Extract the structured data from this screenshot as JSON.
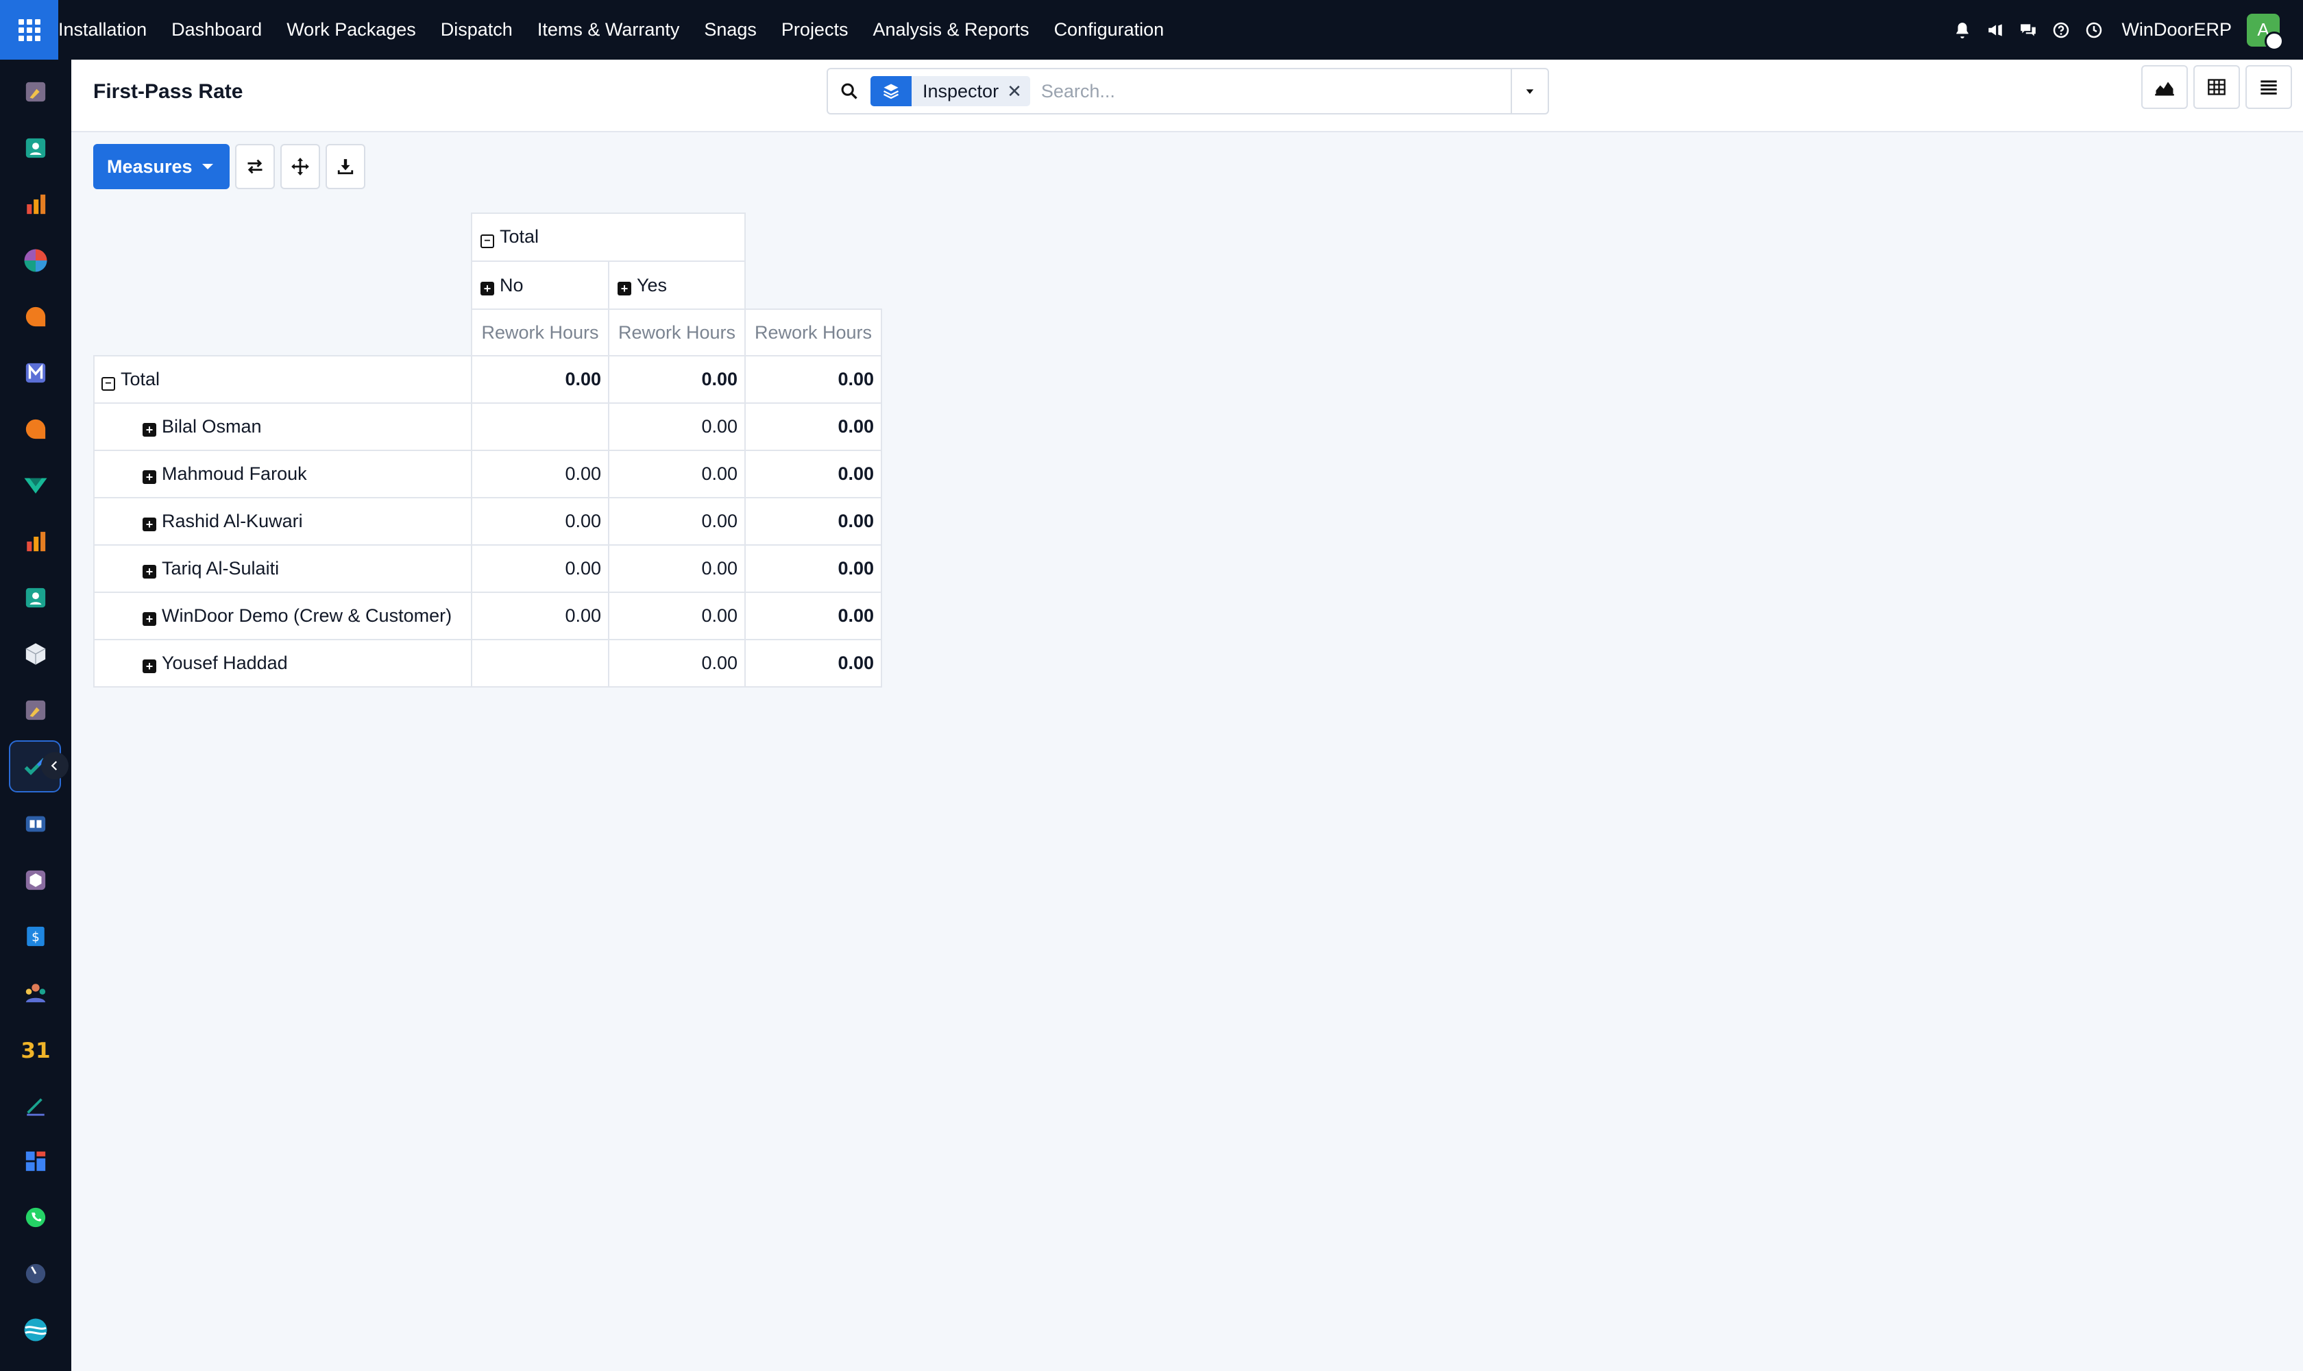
{
  "navbar": {
    "items": [
      "Installation",
      "Dashboard",
      "Work Packages",
      "Dispatch",
      "Items & Warranty",
      "Snags",
      "Projects",
      "Analysis & Reports",
      "Configuration"
    ],
    "company": "WinDoorERP",
    "avatar_initial": "A",
    "accent_color": "#1f6fe0"
  },
  "control_panel": {
    "title": "First-Pass Rate",
    "search": {
      "facet_label": "Inspector",
      "facet_icon": "layers-icon",
      "placeholder": "Search..."
    }
  },
  "toolbar": {
    "measures_label": "Measures"
  },
  "pivot": {
    "col_total_label": "Total",
    "col_groups": [
      "No",
      "Yes"
    ],
    "measure_label": "Rework Hours",
    "total_row": {
      "label": "Total",
      "values": [
        "0.00",
        "0.00",
        "0.00"
      ]
    },
    "rows": [
      {
        "label": "Bilal Osman",
        "values": [
          "",
          "0.00",
          "0.00"
        ]
      },
      {
        "label": "Mahmoud Farouk",
        "values": [
          "0.00",
          "0.00",
          "0.00"
        ]
      },
      {
        "label": "Rashid Al-Kuwari",
        "values": [
          "0.00",
          "0.00",
          "0.00"
        ]
      },
      {
        "label": "Tariq Al-Sulaiti",
        "values": [
          "0.00",
          "0.00",
          "0.00"
        ]
      },
      {
        "label": "WinDoor Demo (Crew & Customer)",
        "values": [
          "0.00",
          "0.00",
          "0.00"
        ]
      },
      {
        "label": "Yousef Haddad",
        "values": [
          "",
          "0.00",
          "0.00"
        ]
      }
    ]
  }
}
